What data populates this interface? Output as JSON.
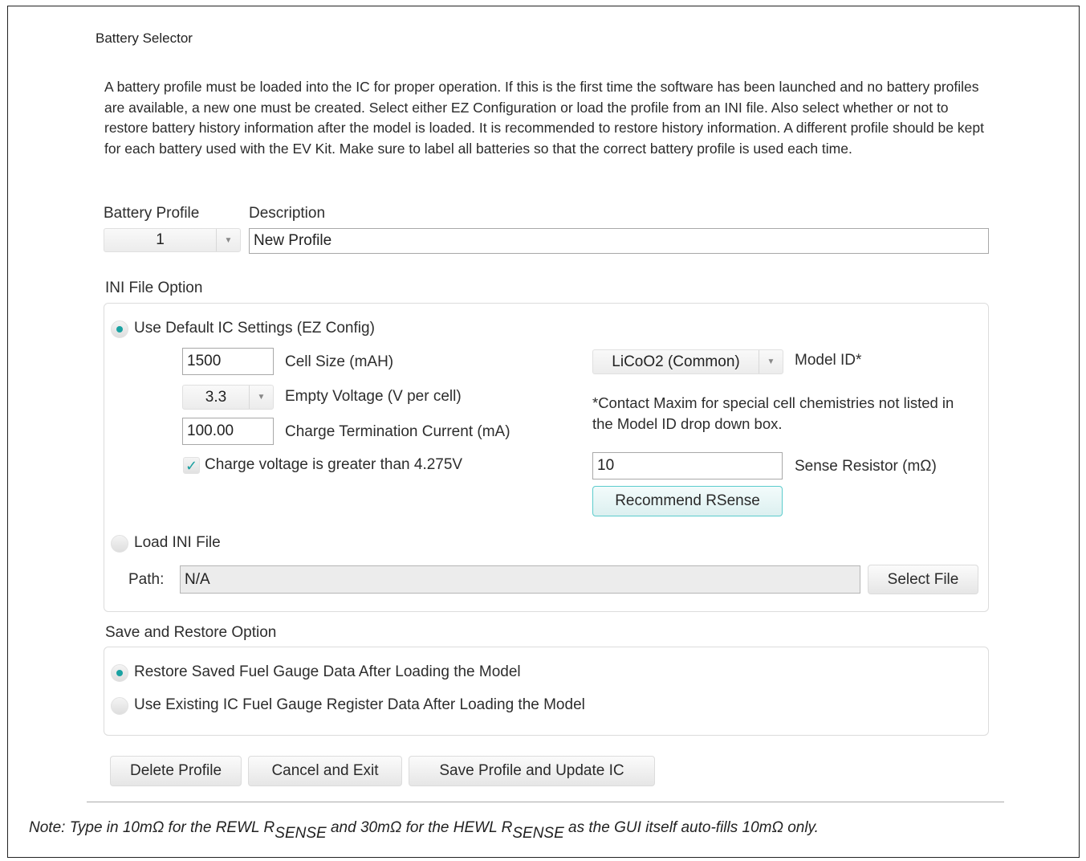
{
  "window": {
    "title": "Battery Selector"
  },
  "intro": "A battery profile must be loaded into the IC for proper operation. If this is the first time the software has been launched and no battery profiles are available, a new one must be created. Select either EZ Configuration or load the profile from an INI file. Also select whether or not to restore battery history information after the model is loaded. It is recommended to restore history information. A different profile should be kept for each battery used with the EV Kit. Make sure to label all batteries so that the correct battery profile is used each time.",
  "profile": {
    "label": "Battery Profile",
    "value": "1",
    "description_label": "Description",
    "description_value": "New Profile"
  },
  "ini": {
    "section_label": "INI File Option",
    "ez_option": {
      "label": "Use Default IC Settings (EZ Config)",
      "selected": true
    },
    "cell_size": {
      "value": "1500",
      "label": "Cell Size (mAH)"
    },
    "empty_voltage": {
      "value": "3.3",
      "label": "Empty Voltage (V per cell)"
    },
    "charge_term": {
      "value": "100.00",
      "label": "Charge Termination Current (mA)"
    },
    "charge_voltage": {
      "label": "Charge voltage is greater than 4.275V",
      "checked": true
    },
    "model_id": {
      "value": "LiCoO2 (Common)",
      "label": "Model ID*"
    },
    "contact_note": "*Contact Maxim for special cell chemistries not listed in the Model ID drop down box.",
    "sense_resistor": {
      "value": "10",
      "label": "Sense Resistor (mΩ)"
    },
    "recommend_button": "Recommend RSense",
    "load_option": {
      "label": "Load INI File",
      "selected": false
    },
    "path_label": "Path:",
    "path_value": "N/A",
    "select_file_button": "Select File"
  },
  "save_restore": {
    "section_label": "Save and Restore Option",
    "restore_option": {
      "label": "Restore Saved Fuel Gauge Data After Loading the Model",
      "selected": true
    },
    "existing_option": {
      "label": "Use Existing IC Fuel Gauge Register Data After Loading the Model",
      "selected": false
    }
  },
  "buttons": {
    "delete": "Delete Profile",
    "cancel": "Cancel and Exit",
    "save": "Save Profile and Update IC"
  },
  "note": {
    "part1": "Note: Type in 10mΩ for the REWL R",
    "sub1": "SENSE",
    "part2": " and 30mΩ for the HEWL R",
    "sub2": "SENSE",
    "part3": " as the GUI itself auto-fills 10mΩ only."
  },
  "colors": {
    "accent": "#1aa2a2",
    "accent_border": "#5ccccd"
  }
}
